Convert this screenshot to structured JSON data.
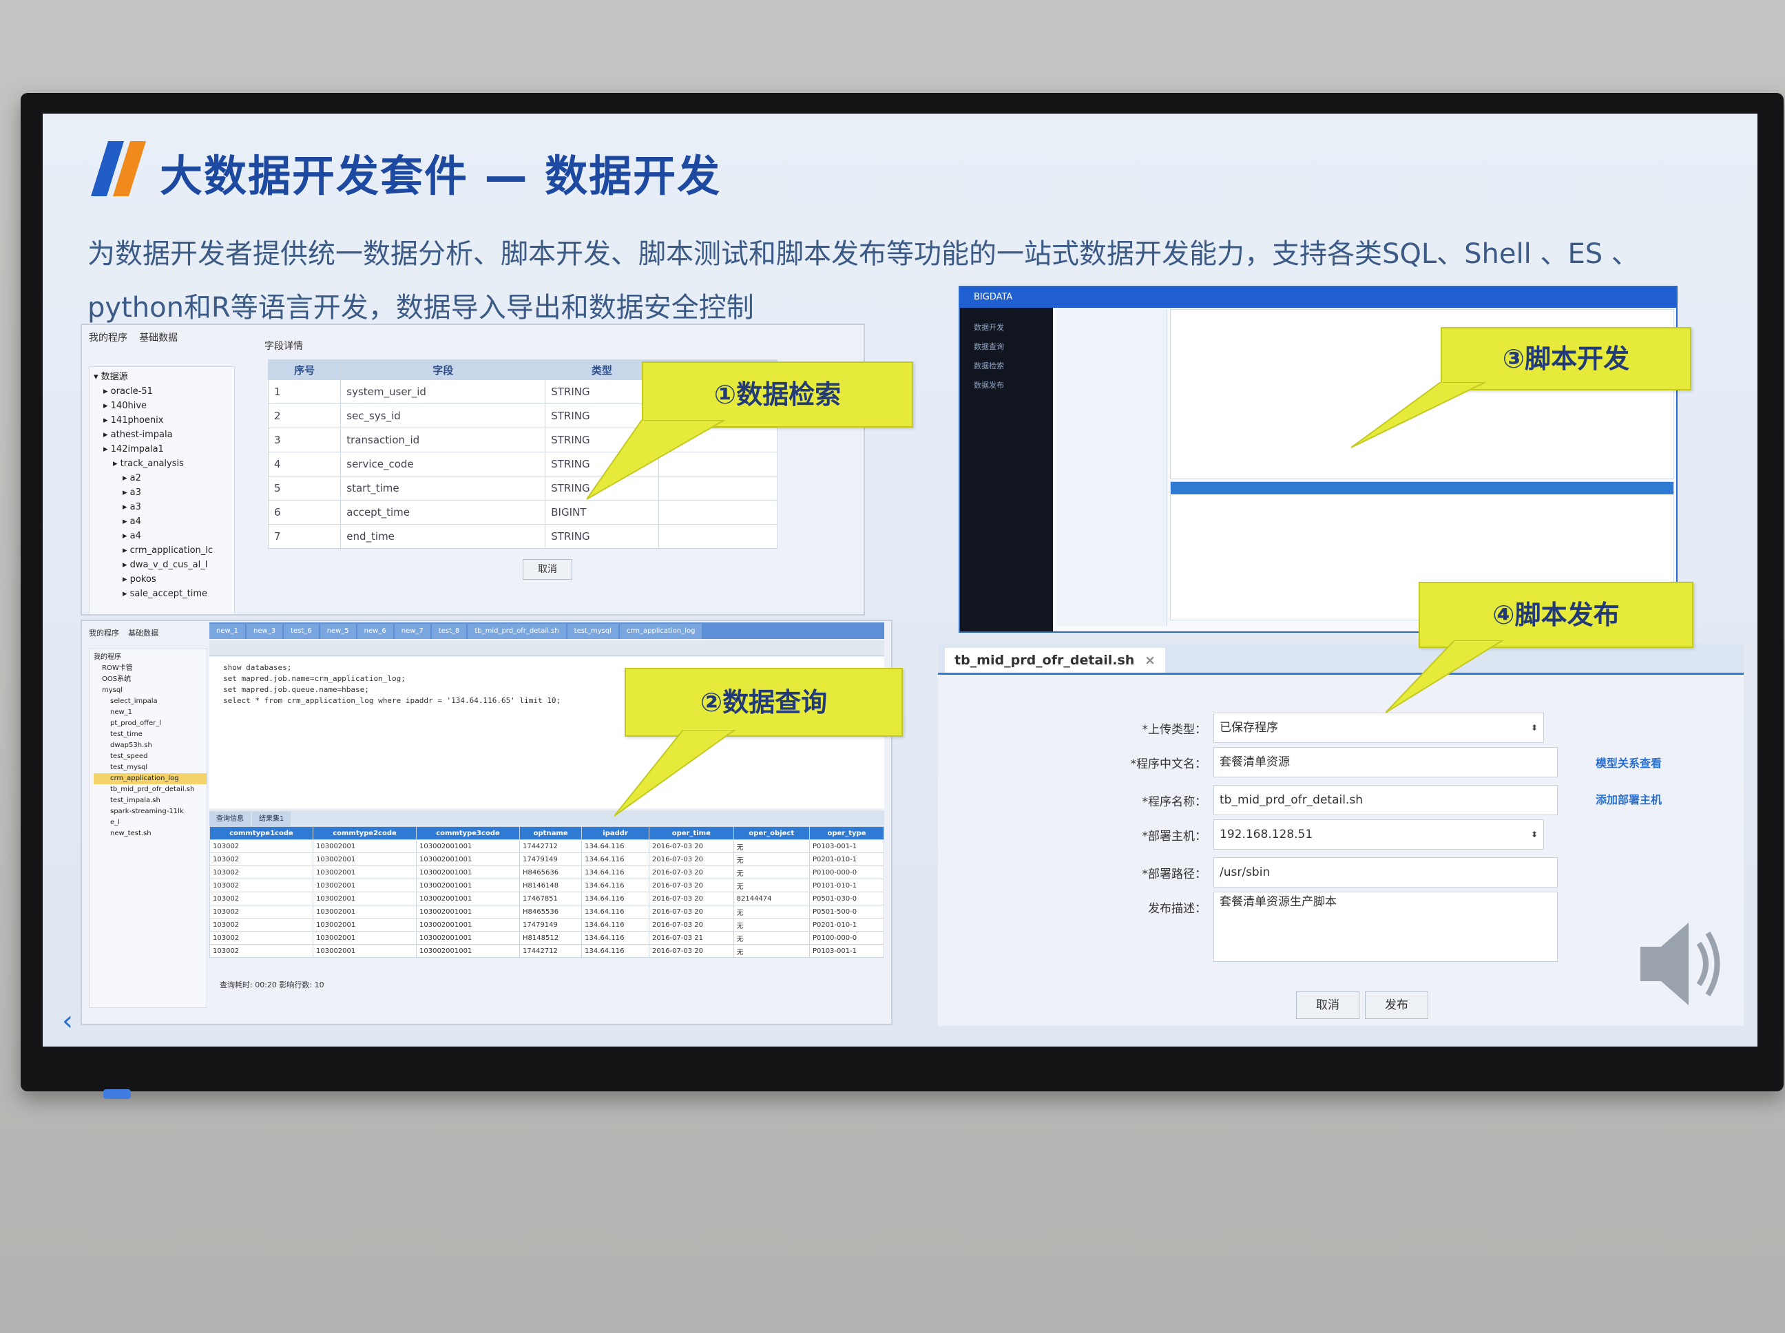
{
  "slide": {
    "title": "大数据开发套件 — 数据开发",
    "description": "为数据开发者提供统一数据分析、脚本开发、脚本测试和脚本发布等功能的一站式数据开发能力，支持各类SQL、Shell 、ES 、 python和R等语言开发，数据导入导出和数据安全控制"
  },
  "colors": {
    "title": "#1d4aa0",
    "callout": "#e6ea3a",
    "logo_blue": "#1f5cc6",
    "logo_orange": "#f08a1c"
  },
  "callouts": {
    "c1": "①数据检索",
    "c2": "②数据查询",
    "c3": "③脚本开发",
    "c4": "④脚本发布"
  },
  "retrieval": {
    "tabs": [
      "我的程序",
      "基础数据"
    ],
    "tree": [
      "数据源",
      "oracle-51",
      "140hive",
      "141phoenix",
      "athest-impala",
      "142impala1",
      "track_analysis",
      "a2",
      "a3",
      "a3",
      "a4",
      "a4",
      "crm_application_lc",
      "dwa_v_d_cus_al_l",
      "pokos",
      "sale_accept_time"
    ],
    "table_title": "字段详情",
    "headers": [
      "序号",
      "字段",
      "类型",
      "描述信息"
    ],
    "rows": [
      [
        "1",
        "system_user_id",
        "STRING",
        ""
      ],
      [
        "2",
        "sec_sys_id",
        "STRING",
        ""
      ],
      [
        "3",
        "transaction_id",
        "STRING",
        ""
      ],
      [
        "4",
        "service_code",
        "STRING",
        ""
      ],
      [
        "5",
        "start_time",
        "STRING",
        ""
      ],
      [
        "6",
        "accept_time",
        "BIGINT",
        ""
      ],
      [
        "7",
        "end_time",
        "STRING",
        ""
      ]
    ],
    "cancel": "取消"
  },
  "query": {
    "tree_tabs": [
      "我的程序",
      "基础数据"
    ],
    "tree": [
      "我的程序",
      "ROW卡管",
      "OOS系统",
      "mysql",
      "select_impala",
      "new_1",
      "pt_prod_offer_l",
      "test_time",
      "dwap53h.sh",
      "test_speed",
      "test_mysql",
      "crm_application_log",
      "tb_mid_prd_ofr_detail.sh",
      "test_impala.sh",
      "spark-streaming-11lk",
      "e_l",
      "new_test.sh"
    ],
    "editor_tabs": [
      "new_1",
      "new_3",
      "test_6",
      "new_5",
      "new_6",
      "new_7",
      "test_8",
      "tb_mid_prd_ofr_detail.sh",
      "test_mysql",
      "crm_application_log"
    ],
    "code": [
      "show databases;",
      "set mapred.job.name=crm_application_log;",
      "set mapred.job.queue.name=hbase;",
      "select * from crm_application_log where ipaddr = '134.64.116.65' limit 10;"
    ],
    "result_tabs": [
      "查询信息",
      "结果集1"
    ],
    "headers": [
      "commtype1code",
      "commtype2code",
      "commtype3code",
      "optname",
      "ipaddr",
      "oper_time",
      "oper_object",
      "oper_type"
    ],
    "rows": [
      [
        "103002",
        "103002001",
        "103002001001",
        "17442712",
        "134.64.116",
        "2016-07-03 20",
        "无",
        "P0103-001-1"
      ],
      [
        "103002",
        "103002001",
        "103002001001",
        "17479149",
        "134.64.116",
        "2016-07-03 20",
        "无",
        "P0201-010-1"
      ],
      [
        "103002",
        "103002001",
        "103002001001",
        "H8465636",
        "134.64.116",
        "2016-07-03 20",
        "无",
        "P0100-000-0"
      ],
      [
        "103002",
        "103002001",
        "103002001001",
        "H8146148",
        "134.64.116",
        "2016-07-03 20",
        "无",
        "P0101-010-1"
      ],
      [
        "103002",
        "103002001",
        "103002001001",
        "17467851",
        "134.64.116",
        "2016-07-03 20",
        "82144474",
        "P0501-030-0"
      ],
      [
        "103002",
        "103002001",
        "103002001001",
        "H8465536",
        "134.64.116",
        "2016-07-03 20",
        "无",
        "P0501-500-0"
      ],
      [
        "103002",
        "103002001",
        "103002001001",
        "17479149",
        "134.64.116",
        "2016-07-03 20",
        "无",
        "P0201-010-1"
      ],
      [
        "103002",
        "103002001",
        "103002001001",
        "H8148512",
        "134.64.116",
        "2016-07-03 21",
        "无",
        "P0100-000-0"
      ],
      [
        "103002",
        "103002001",
        "103002001001",
        "17442712",
        "134.64.116",
        "2016-07-03 20",
        "无",
        "P0103-001-1"
      ]
    ],
    "status": "查询耗时: 00:20    影响行数: 10"
  },
  "devide": {
    "header": "BIGDATA",
    "menu": [
      "数据开发",
      "数据查询",
      "数据检索",
      "数据发布"
    ]
  },
  "publish": {
    "tab": "tb_mid_prd_ofr_detail.sh",
    "fields": [
      {
        "label": "*上传类型：",
        "value": "已保存程序"
      },
      {
        "label": "*程序中文名：",
        "value": "套餐清单资源"
      },
      {
        "label": "*程序名称：",
        "value": "tb_mid_prd_ofr_detail.sh"
      },
      {
        "label": "*部署主机：",
        "value": "192.168.128.51"
      },
      {
        "label": "*部署路径：",
        "value": "/usr/sbin"
      },
      {
        "label": "发布描述：",
        "value": "套餐清单资源生产脚本"
      }
    ],
    "links": [
      "模型关系查看",
      "添加部署主机"
    ],
    "cancel": "取消",
    "submit": "发布"
  }
}
